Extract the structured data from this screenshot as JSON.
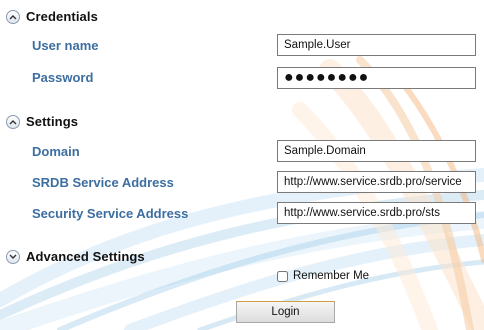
{
  "colors": {
    "label": "#3d6ea0",
    "accent_blue": "#9ec9e8",
    "accent_orange": "#f5b070"
  },
  "sections": {
    "credentials": {
      "title": "Credentials",
      "icon": "chevron-up-icon"
    },
    "settings": {
      "title": "Settings",
      "icon": "chevron-up-icon"
    },
    "advanced": {
      "title": "Advanced Settings",
      "icon": "chevron-down-icon"
    }
  },
  "fields": {
    "username": {
      "label": "User name",
      "value": "Sample.User"
    },
    "password": {
      "label": "Password",
      "value": "●●●●●●●●"
    },
    "domain": {
      "label": "Domain",
      "value": "Sample.Domain"
    },
    "srdb_service_address": {
      "label": "SRDB Service Address",
      "value": "http://www.service.srdb.pro/service"
    },
    "security_service_address": {
      "label": "Security Service Address",
      "value": "http://www.service.srdb.pro/sts"
    }
  },
  "remember_me": {
    "label": "Remember Me",
    "checked": false
  },
  "login_button": {
    "label": "Login"
  }
}
